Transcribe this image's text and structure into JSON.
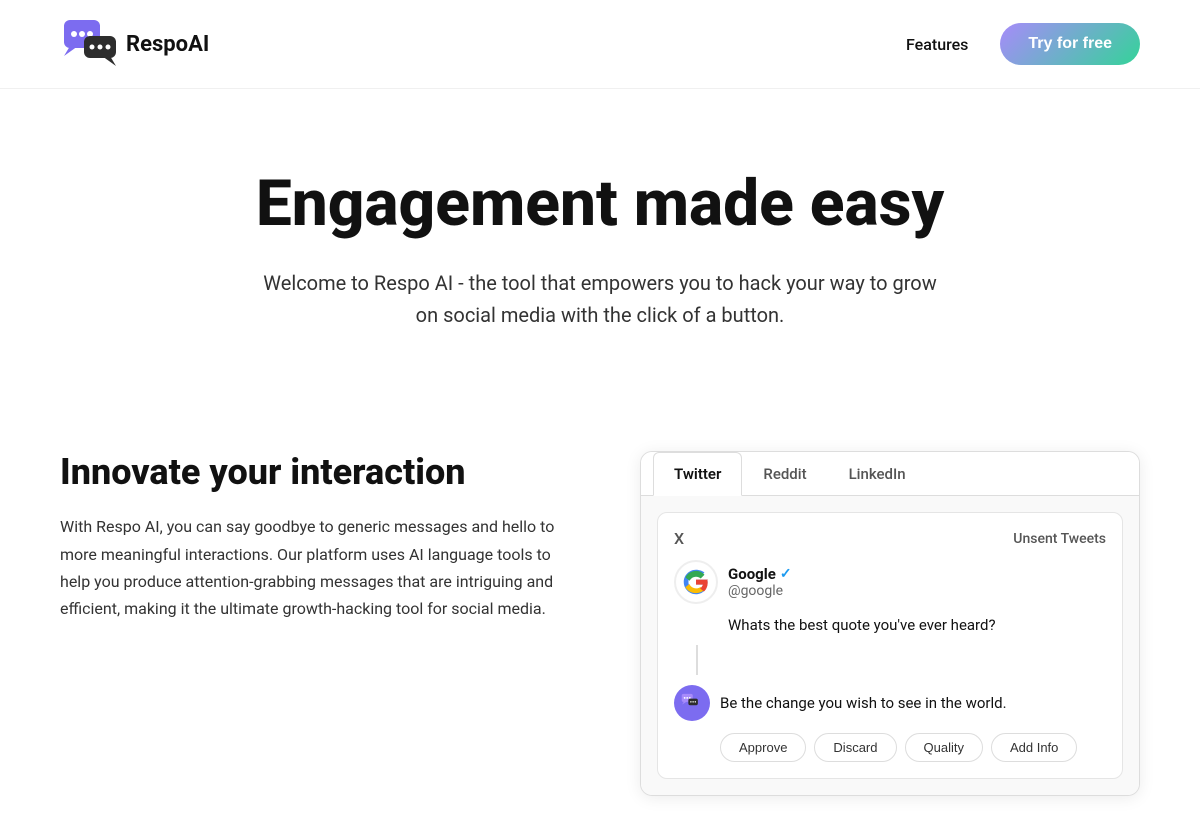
{
  "nav": {
    "logo_text": "RespoAI",
    "features_label": "Features",
    "try_btn_label": "Try for free"
  },
  "hero": {
    "headline": "Engagement made easy",
    "subtext": "Welcome to Respo AI - the tool that empowers you to hack your way to grow on social media with the click of a button."
  },
  "features": {
    "heading": "Innovate your interaction",
    "body": "With Respo AI, you can say goodbye to generic messages and hello to more meaningful interactions. Our platform uses AI language tools to help you produce attention-grabbing messages that are intriguing and efficient, making it the ultimate growth-hacking tool for social media."
  },
  "demo": {
    "tabs": [
      "Twitter",
      "Reddit",
      "LinkedIn"
    ],
    "active_tab": "Twitter",
    "tweet": {
      "x_label": "X",
      "unsent_label": "Unsent Tweets",
      "author_name": "Google",
      "author_verified": true,
      "author_handle": "@google",
      "question": "Whats the best quote you've ever heard?",
      "reply_text": "Be the change you wish to see in the world.",
      "reply_buttons": [
        "Approve",
        "Discard",
        "Quality",
        "Add Info"
      ]
    }
  }
}
